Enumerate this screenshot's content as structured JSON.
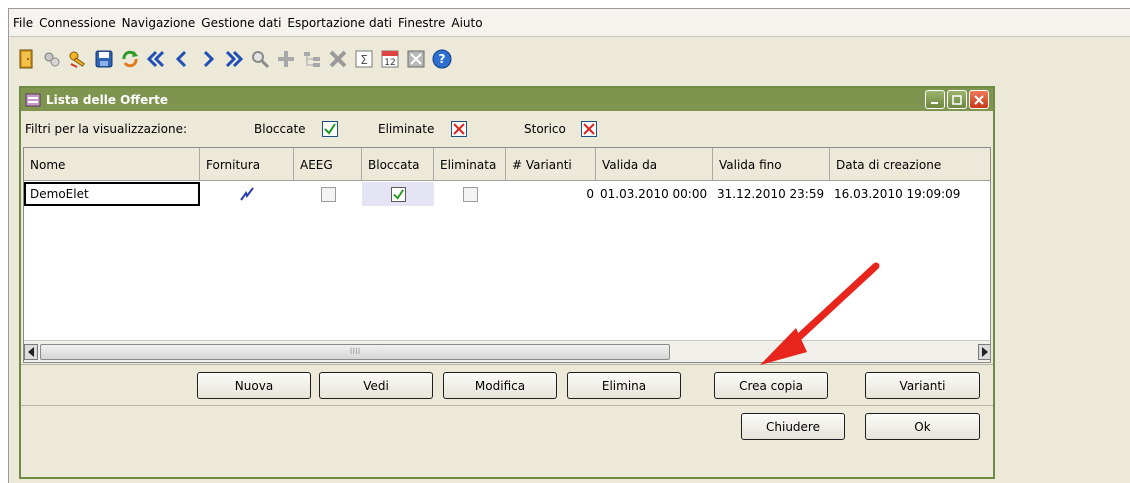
{
  "menu": [
    "File",
    "Connessione",
    "Navigazione",
    "Gestione dati",
    "Esportazione dati",
    "Finestre",
    "Aiuto"
  ],
  "toolbar": {
    "icons": [
      "exit-door-icon",
      "settings-icon",
      "key-icon",
      "save-icon",
      "refresh-icon",
      "first-record-icon",
      "previous-record-icon",
      "next-record-icon",
      "last-record-icon",
      "search-icon",
      "add-icon",
      "tree-icon",
      "delete-icon",
      "sum-icon",
      "calendar-icon",
      "export-icon",
      "help-icon"
    ],
    "calendar_day": "12",
    "sum_glyph": "Σ"
  },
  "window": {
    "title": "Lista delle Offerte",
    "filters_label": "Filtri per la visualizzazione:",
    "filters": [
      {
        "label": "Bloccate",
        "state": "checked"
      },
      {
        "label": "Eliminate",
        "state": "crossed"
      },
      {
        "label": "Storico",
        "state": "crossed"
      }
    ]
  },
  "table": {
    "columns": [
      "Nome",
      "Fornitura",
      "AEEG",
      "Bloccata",
      "Eliminata",
      "# Varianti",
      "Valida da",
      "Valida fino",
      "Data di creazione"
    ],
    "rows": [
      {
        "nome": "DemoElet",
        "fornitura_icon": "electricity-icon",
        "aeeg": false,
        "bloccata": true,
        "eliminata": false,
        "varianti": "0",
        "valida_da": "01.03.2010 00:00",
        "valida_fino": "31.12.2010 23:59",
        "data_creazione": "16.03.2010 19:09:09"
      }
    ],
    "scroll_grip": "IIII"
  },
  "buttons": {
    "nuova": "Nuova",
    "vedi": "Vedi",
    "modifica": "Modifica",
    "elimina": "Elimina",
    "crea_copia": "Crea copia",
    "varianti": "Varianti",
    "chiudere": "Chiudere",
    "ok": "Ok"
  },
  "colors": {
    "title_bar": "#7f944f",
    "annotation_arrow": "#e8251c"
  }
}
